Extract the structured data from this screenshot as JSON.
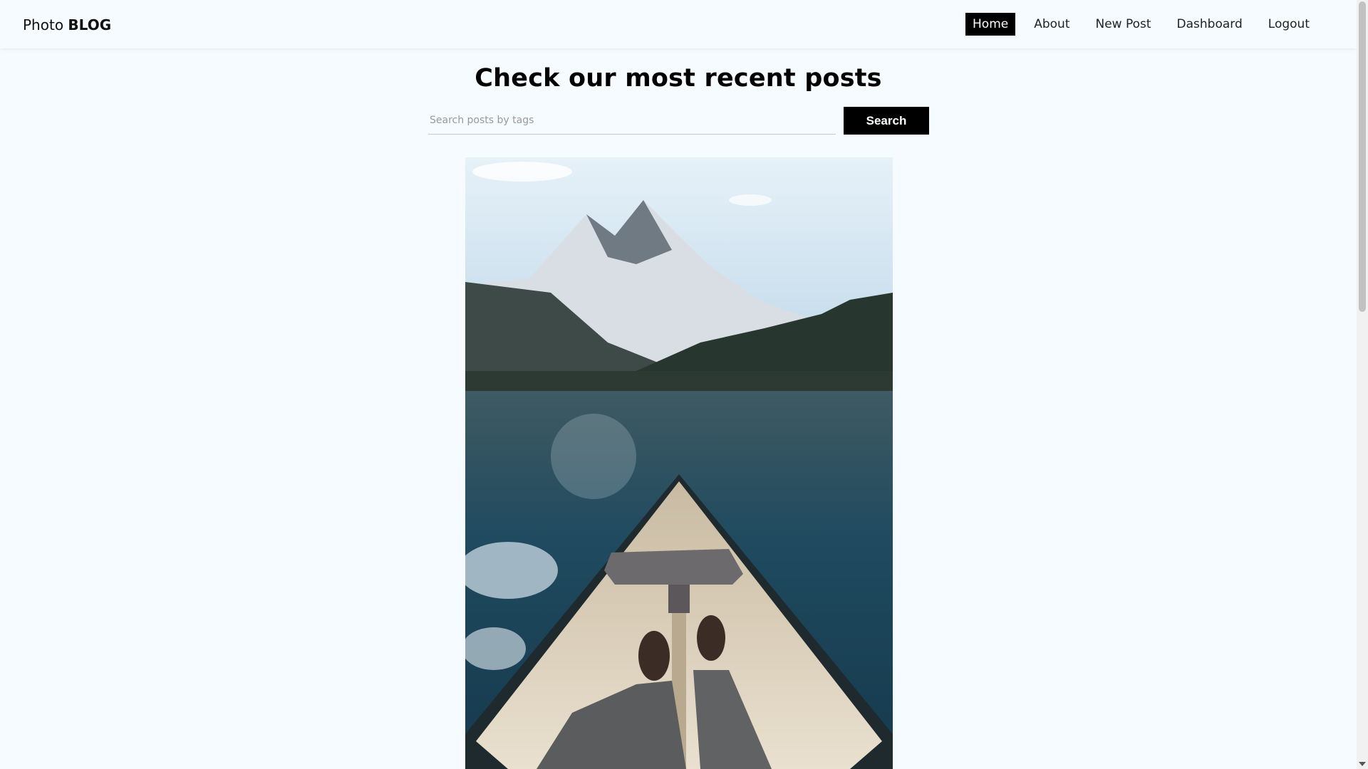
{
  "brand": {
    "light": "Photo",
    "bold": "BLOG"
  },
  "nav": {
    "home": "Home",
    "about": "About",
    "new_post": "New Post",
    "dashboard": "Dashboard",
    "logout": "Logout"
  },
  "main": {
    "title": "Check our most recent posts",
    "search_placeholder": "Search posts by tags",
    "search_value": "",
    "search_button": "Search"
  },
  "post": {
    "image_icon": "mountain-lake-canoe-photo"
  },
  "colors": {
    "accent": "#000000",
    "background": "#f5fbff"
  }
}
